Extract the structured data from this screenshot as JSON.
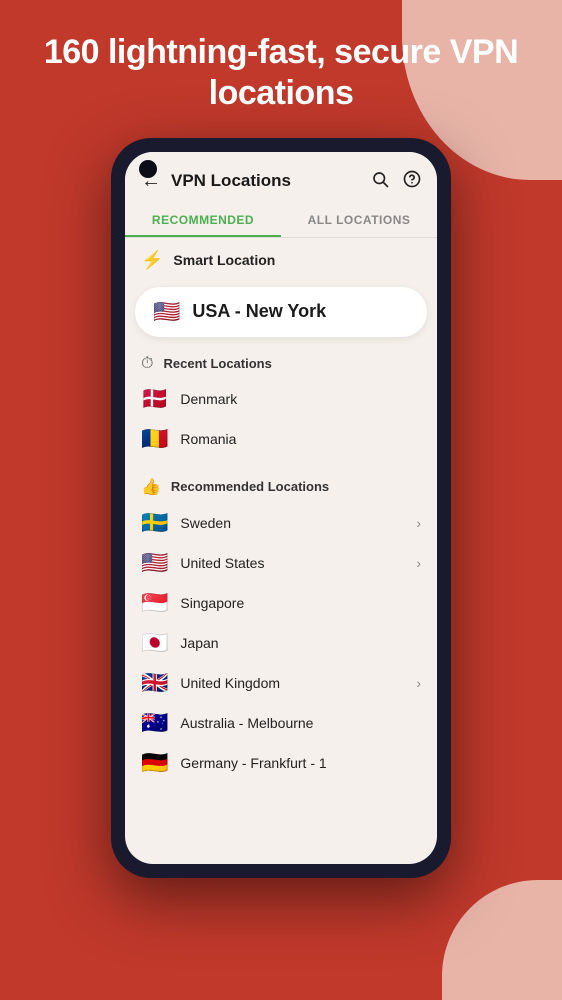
{
  "page": {
    "background_color": "#c0392b",
    "header": {
      "title": "160 lightning-fast, secure VPN locations"
    },
    "phone": {
      "app_bar": {
        "back_label": "←",
        "title": "VPN Locations",
        "search_icon": "search",
        "help_icon": "help"
      },
      "tabs": [
        {
          "label": "RECOMMENDED",
          "active": true
        },
        {
          "label": "ALL LOCATIONS",
          "active": false
        }
      ],
      "smart_location": {
        "label": "Smart Location"
      },
      "selected_location": {
        "flag": "🇺🇸",
        "name": "USA - New York"
      },
      "recent_section": {
        "icon": "⏱",
        "title": "Recent Locations",
        "items": [
          {
            "flag": "🇩🇰",
            "name": "Denmark",
            "has_chevron": false
          },
          {
            "flag": "🇷🇴",
            "name": "Romania",
            "has_chevron": false
          }
        ]
      },
      "recommended_section": {
        "icon": "👍",
        "title": "Recommended Locations",
        "items": [
          {
            "flag": "🇸🇪",
            "name": "Sweden",
            "has_chevron": true
          },
          {
            "flag": "🇺🇸",
            "name": "United States",
            "has_chevron": true
          },
          {
            "flag": "🇸🇬",
            "name": "Singapore",
            "has_chevron": false
          },
          {
            "flag": "🇯🇵",
            "name": "Japan",
            "has_chevron": false
          },
          {
            "flag": "🇬🇧",
            "name": "United Kingdom",
            "has_chevron": true
          },
          {
            "flag": "🇦🇺",
            "name": "Australia - Melbourne",
            "has_chevron": false
          },
          {
            "flag": "🇩🇪",
            "name": "Germany - Frankfurt - 1",
            "has_chevron": false
          }
        ]
      }
    }
  }
}
